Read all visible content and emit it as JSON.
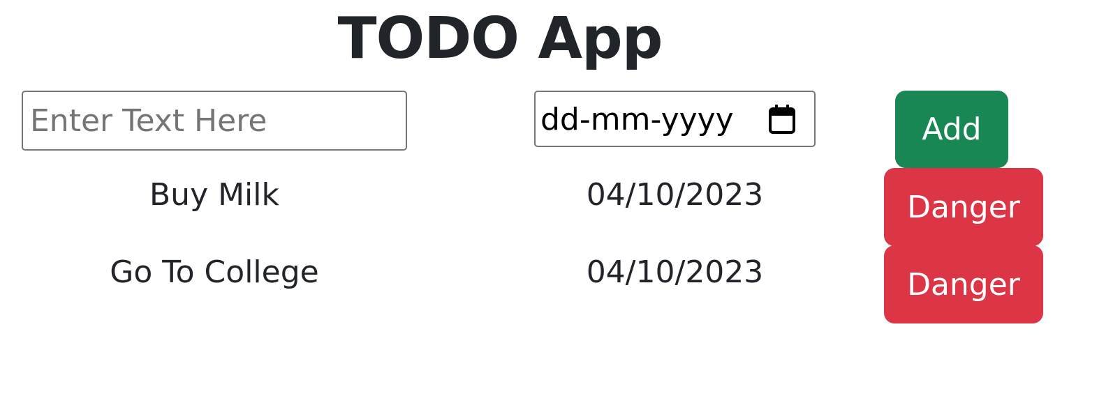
{
  "app": {
    "title": "TODO App"
  },
  "form": {
    "text_placeholder": "Enter Text Here",
    "date_value": "dd-mm-yyyy",
    "date_icon": "calendar-icon",
    "add_label": "Add"
  },
  "todos": [
    {
      "name": "Buy Milk",
      "date": "04/10/2023",
      "action_label": "Danger"
    },
    {
      "name": "Go To College",
      "date": "04/10/2023",
      "action_label": "Danger"
    }
  ],
  "colors": {
    "add_button": "#198754",
    "danger_button": "#dc3545",
    "text": "#212529"
  }
}
